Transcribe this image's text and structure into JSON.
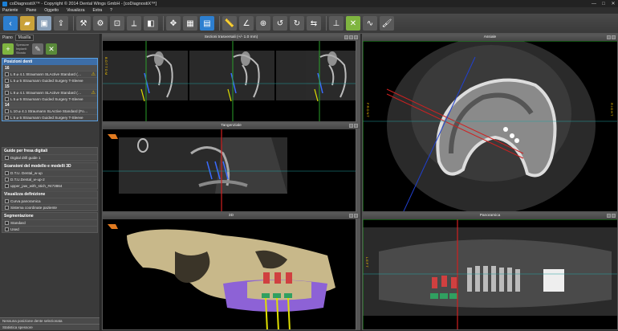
{
  "window": {
    "title": "coDiagnostiX™ - Copyright © 2014 Dental Wings GmbH - [coDiagnostiX™]",
    "min": "—",
    "max": "□",
    "close": "✕"
  },
  "menu": [
    "Paziente",
    "Piano",
    "Oggetto",
    "Visualizza",
    "Extra",
    "?"
  ],
  "panel": {
    "head": "Piano",
    "head_value": "Masilla",
    "quick_labels": [
      "Spessore",
      "Impianti",
      "Sfondo"
    ],
    "implants": {
      "title": "Posizioni denti",
      "groups": [
        {
          "tooth": "16",
          "rows": [
            {
              "label": "L 8 ⌀ 4.1  Straumann SLActive Standard (…",
              "warn": "⚠"
            },
            {
              "label": "L 5 ⌀ 5  Straumann Guided Surgery T-Sleeve",
              "warn": ""
            }
          ]
        },
        {
          "tooth": "15",
          "rows": [
            {
              "label": "L 8 ⌀ 4.1  Straumann SLActive Standard (…",
              "warn": "⚠"
            },
            {
              "label": "L 5 ⌀ 5  Straumann Guided Surgery T-Sleeve",
              "warn": ""
            }
          ]
        },
        {
          "tooth": "14",
          "rows": [
            {
              "label": "L 10 ⌀ 4.1  Straumann SLActive Standard (Fo…",
              "warn": ""
            },
            {
              "label": "L 5 ⌀ 5  Straumann Guided Surgery T-Sleeve",
              "warn": ""
            }
          ]
        }
      ]
    },
    "guides": {
      "title": "Guide per fresa digitali",
      "rows": [
        "Digital drill guide 1"
      ]
    },
    "scans": {
      "title": "Scansioni del modello e modelli 3D",
      "rows": [
        "D.T.U. Dental_w-up",
        "D.T.U.Dental_w-up-2",
        "upper_jaw_with_stich_#473864"
      ]
    },
    "vis": {
      "title": "Visualizza definizione",
      "rows": [
        "Curva panoramica",
        "Sistema coordinate paziente"
      ]
    },
    "seg": {
      "title": "Segmentazione",
      "rows": [
        "Standard",
        "Used"
      ]
    },
    "footer1": "Nessuna posizione dente selezionata",
    "footer2": "Statistica spessore"
  },
  "panes": {
    "cross": "Sezioni trasversali (+/- 1.0 mm)",
    "axial": "Assiale",
    "tangential": "Tangenziale",
    "view3d": "3D",
    "pano": "Panoramica"
  },
  "orient": {
    "bottom": "BOTTOM",
    "front": "FRONT",
    "left": "LEFT",
    "tiright": "RIGHT"
  }
}
